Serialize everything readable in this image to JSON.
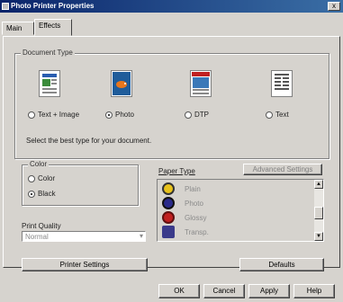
{
  "window": {
    "title": "Photo Printer Properties",
    "close_label": "x"
  },
  "tabs": [
    {
      "label": "Main"
    },
    {
      "label": "Effects"
    }
  ],
  "document_group": {
    "legend": "Document Type",
    "types": [
      {
        "label": "Text + Image",
        "icon": "text-image-doc-icon",
        "selected": false
      },
      {
        "label": "Photo",
        "icon": "photo-doc-icon",
        "selected": true
      },
      {
        "label": "DTP",
        "icon": "dtp-doc-icon",
        "selected": false
      },
      {
        "label": "Text",
        "icon": "text-doc-icon",
        "selected": false
      }
    ],
    "hint": "Select the best type for your document."
  },
  "color_group": {
    "legend": "Color",
    "options": [
      {
        "label": "Color",
        "selected": false
      },
      {
        "label": "Black",
        "selected": true
      }
    ]
  },
  "print_quality": {
    "label": "Print Quality",
    "value": "Normal"
  },
  "paper_list": {
    "header_label": "Paper Type",
    "advanced_label": "Advanced Settings",
    "items": [
      {
        "label": "Plain"
      },
      {
        "label": "Photo"
      },
      {
        "label": "Glossy"
      },
      {
        "label": "Transp."
      }
    ]
  },
  "bottom_buttons": {
    "left": "Printer Settings",
    "right": "Defaults"
  },
  "dialog_buttons": {
    "ok": "OK",
    "cancel": "Cancel",
    "apply": "Apply",
    "help": "Help"
  },
  "colors": {
    "titlebar": "#0a246a",
    "dialog": "#d6d3ce"
  }
}
